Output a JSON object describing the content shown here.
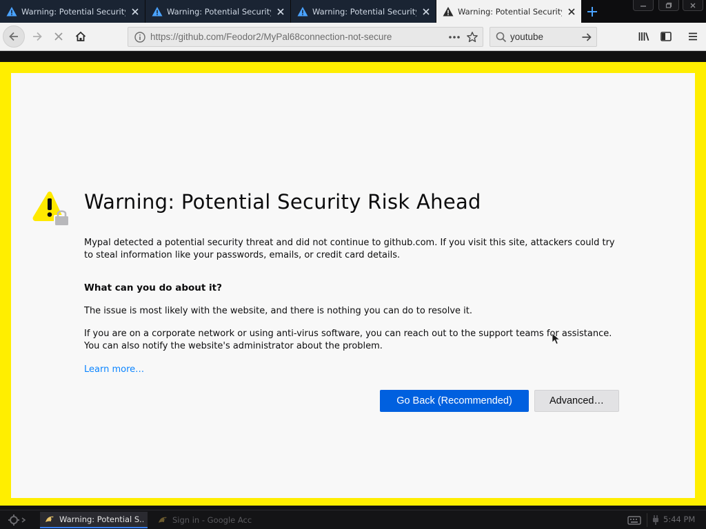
{
  "tabs": [
    {
      "title": "Warning: Potential Security Risk Ahead",
      "active": false
    },
    {
      "title": "Warning: Potential Security Risk Ahead",
      "active": false
    },
    {
      "title": "Warning: Potential Security Risk Ahead",
      "active": false
    },
    {
      "title": "Warning: Potential Security Risk Ahead",
      "active": true
    }
  ],
  "address_bar": {
    "url": "https://github.com/Feodor2/MyPal68connection-not-secure"
  },
  "search_bar": {
    "value": "youtube"
  },
  "page": {
    "title": "Warning: Potential Security Risk Ahead",
    "intro": "Mypal detected a potential security threat and did not continue to github.com. If you visit this site, attackers could try to steal information like your passwords, emails, or credit card details.",
    "subheading": "What can you do about it?",
    "para1": "The issue is most likely with the website, and there is nothing you can do to resolve it.",
    "para2": "If you are on a corporate network or using anti-virus software, you can reach out to the support teams for assistance. You can also notify the website's administrator about the problem.",
    "learn_more": "Learn more…",
    "go_back": "Go Back (Recommended)",
    "advanced": "Advanced…"
  },
  "taskbar": {
    "tasks": [
      {
        "label": "Warning: Potential S...",
        "active": true
      },
      {
        "label": "Sign in - Google Acc...",
        "active": false
      }
    ],
    "clock": "5:44 PM"
  },
  "colors": {
    "accent": "#0060df",
    "link": "#0a84ff",
    "warning": "#ffe900",
    "page_frame": "#ffee00"
  }
}
